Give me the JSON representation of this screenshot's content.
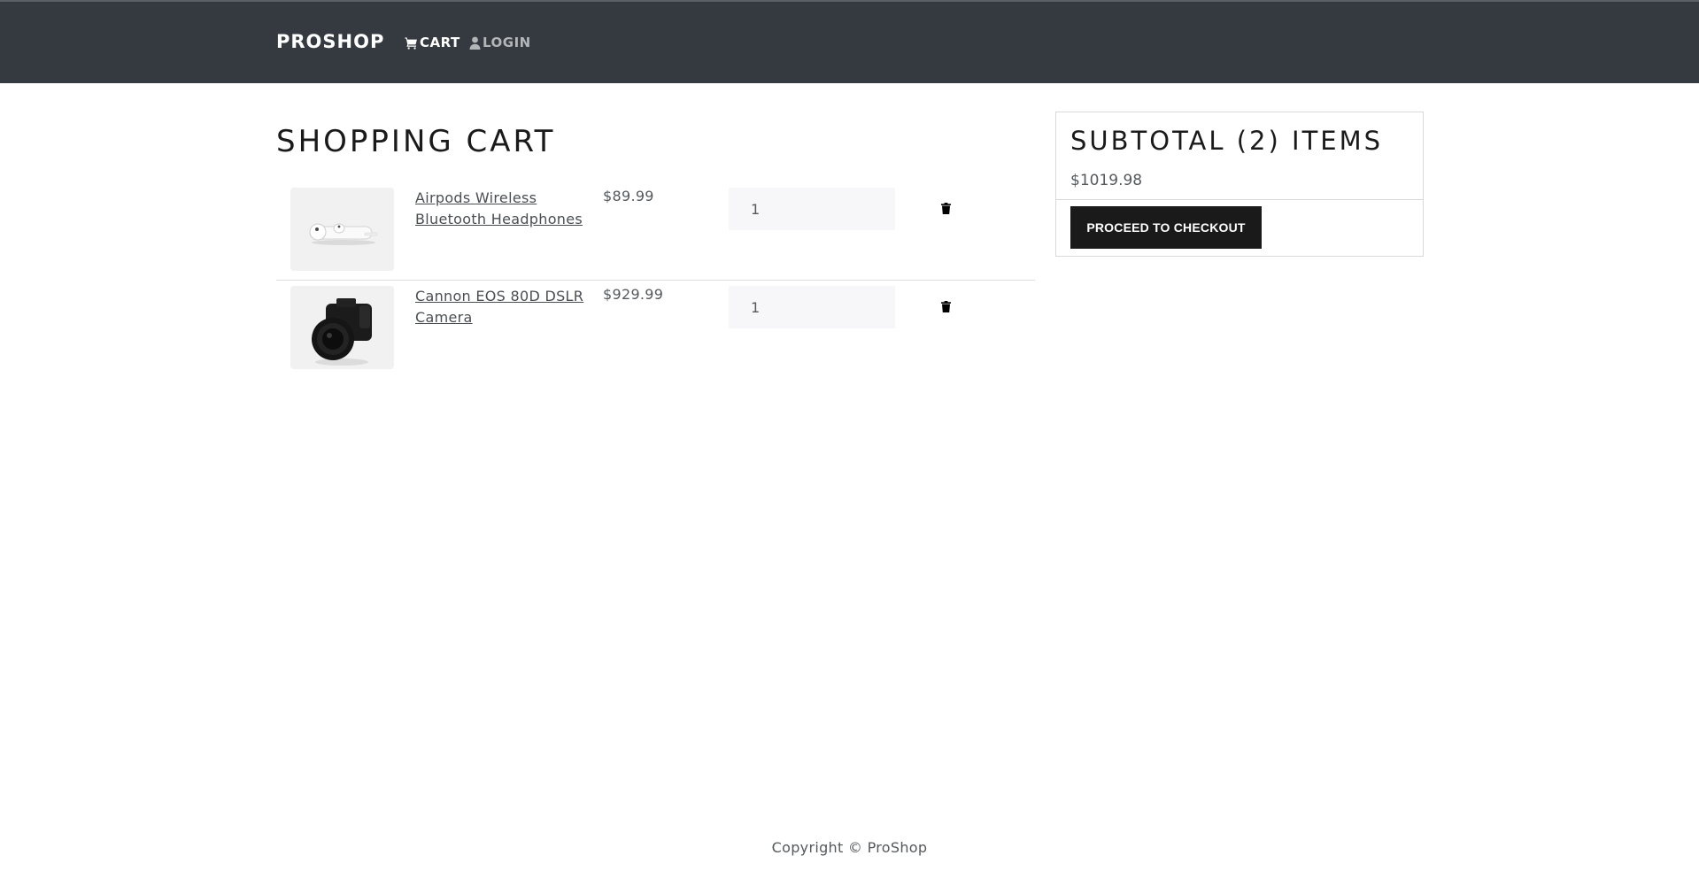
{
  "header": {
    "brand": "PROSHOP",
    "nav": {
      "cart_icon": "shopping-cart-icon",
      "cart_label": "CART",
      "login_icon": "user-icon",
      "login_label": "LOGIN"
    }
  },
  "main": {
    "title": "SHOPPING CART",
    "items": [
      {
        "name": "Airpods Wireless Bluetooth Headphones",
        "price": "$89.99",
        "quantity": "1",
        "image_icon": "airpods-image",
        "delete_icon": "trash-icon"
      },
      {
        "name": "Cannon EOS 80D DSLR Camera",
        "price": "$929.99",
        "quantity": "1",
        "image_icon": "camera-image",
        "delete_icon": "trash-icon"
      }
    ]
  },
  "summary": {
    "title": "SUBTOTAL (2) ITEMS",
    "total": "$1019.98",
    "checkout_label": "PROCEED TO CHECKOUT"
  },
  "footer": {
    "copyright": "Copyright © ProShop"
  },
  "colors": {
    "navbar_bg": "#343a40",
    "primary_button": "#1a1a1a",
    "input_bg": "#f7f7f9"
  }
}
